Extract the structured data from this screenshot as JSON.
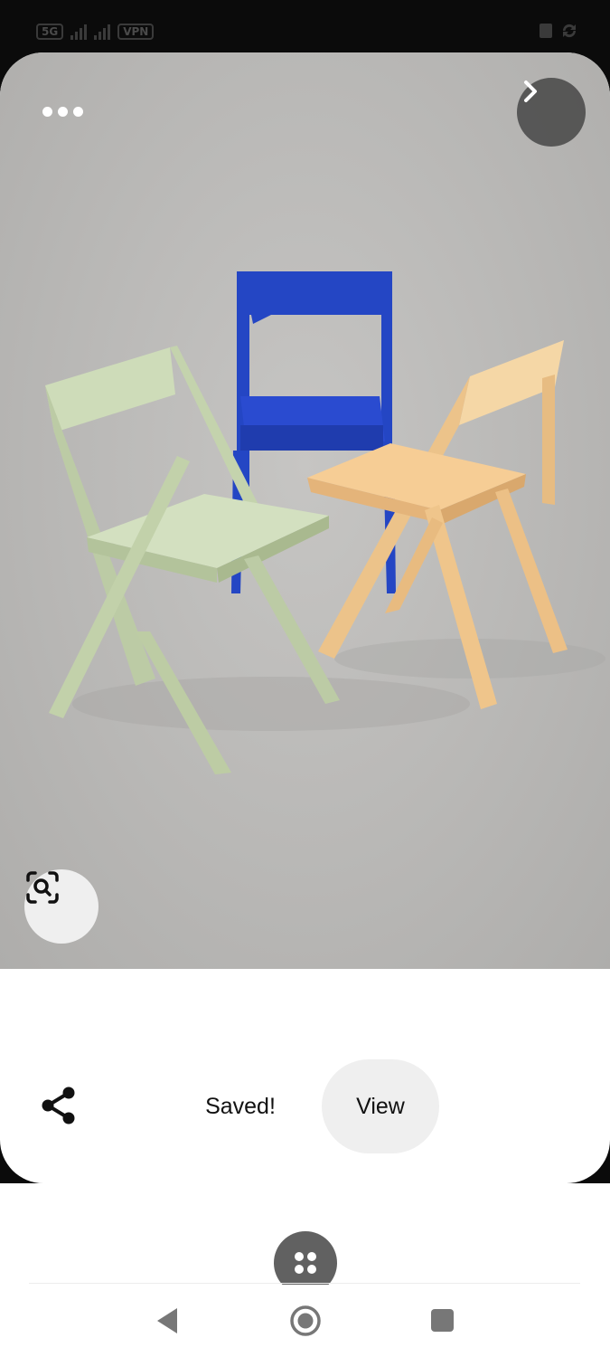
{
  "status_bar": {
    "network_badge": "5G",
    "vpn_badge": "VPN"
  },
  "pin": {
    "image_description_icon": "chairs-photo",
    "more_icon": "more-dots-icon",
    "next_icon": "chevron-right-icon",
    "lens_icon": "visual-search-icon"
  },
  "actions": {
    "share_icon": "share-icon",
    "saved_label": "Saved!",
    "view_label": "View"
  },
  "colors": {
    "accent_button_bg": "#efefef",
    "chair_green": "#c9d9b3",
    "chair_blue": "#2446c4",
    "chair_peach": "#f2c890"
  },
  "nav": {
    "back_icon": "back-triangle-icon",
    "home_icon": "home-circle-icon",
    "recents_icon": "recents-square-icon"
  }
}
